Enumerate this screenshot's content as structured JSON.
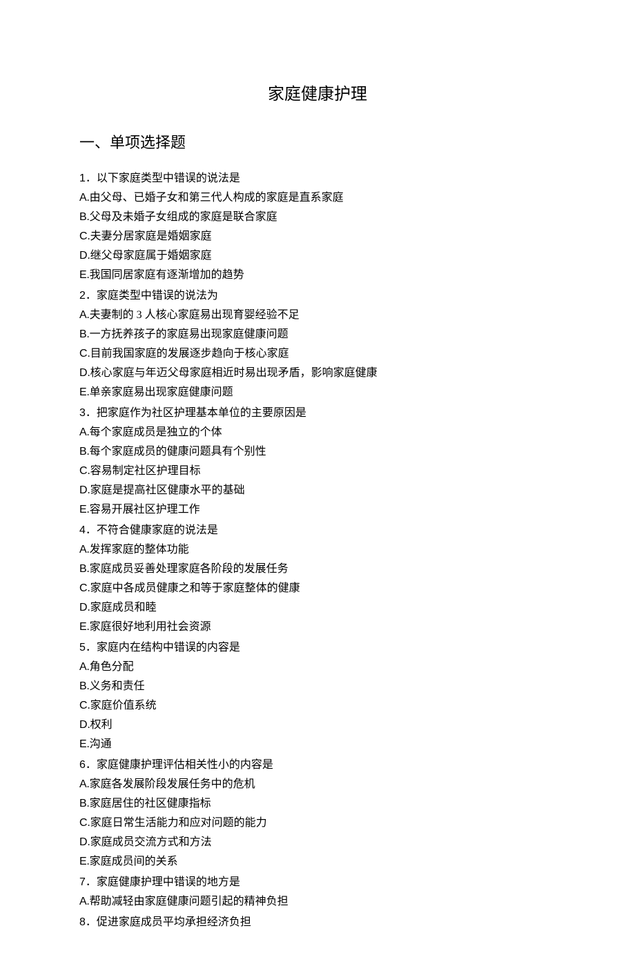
{
  "title": "家庭健康护理",
  "sectionHeading": "一、单项选择题",
  "questions": [
    {
      "number": "1",
      "stem": "．以下家庭类型中错误的说法是",
      "options": [
        {
          "label": "A",
          "text": ".由父母、已婚子女和第三代人构成的家庭是直系家庭"
        },
        {
          "label": "B",
          "text": ".父母及未婚子女组成的家庭是联合家庭"
        },
        {
          "label": "C",
          "text": ".夫妻分居家庭是婚姻家庭"
        },
        {
          "label": "D",
          "text": ".继父母家庭属于婚姻家庭"
        },
        {
          "label": "E",
          "text": ".我国同居家庭有逐渐增加的趋势"
        }
      ]
    },
    {
      "number": "2",
      "stem": "．家庭类型中错误的说法为",
      "options": [
        {
          "label": "A",
          "text": ".夫妻制的 3 人核心家庭易出现育婴经验不足"
        },
        {
          "label": "B",
          "text": ".一方抚养孩子的家庭易出现家庭健康问题"
        },
        {
          "label": "C",
          "text": ".目前我国家庭的发展逐步趋向于核心家庭"
        },
        {
          "label": "D",
          "text": ".核心家庭与年迈父母家庭相近时易出现矛盾，影响家庭健康"
        },
        {
          "label": "E",
          "text": ".单亲家庭易出现家庭健康问题"
        }
      ]
    },
    {
      "number": "3",
      "stem": "．把家庭作为社区护理基本单位的主要原因是",
      "options": [
        {
          "label": "A",
          "text": ".每个家庭成员是独立的个体"
        },
        {
          "label": "B",
          "text": ".每个家庭成员的健康问题具有个别性"
        },
        {
          "label": "C",
          "text": ".容易制定社区护理目标"
        },
        {
          "label": "D",
          "text": ".家庭是提高社区健康水平的基础"
        },
        {
          "label": "E",
          "text": ".容易开展社区护理工作"
        }
      ]
    },
    {
      "number": "4",
      "stem": "．不符合健康家庭的说法是",
      "options": [
        {
          "label": "A",
          "text": ".发挥家庭的整体功能"
        },
        {
          "label": "B",
          "text": ".家庭成员妥善处理家庭各阶段的发展任务"
        },
        {
          "label": "C",
          "text": ".家庭中各成员健康之和等于家庭整体的健康"
        },
        {
          "label": "D",
          "text": ".家庭成员和睦"
        },
        {
          "label": "E",
          "text": ".家庭很好地利用社会资源"
        }
      ]
    },
    {
      "number": "5",
      "stem": "．家庭内在结构中错误的内容是",
      "options": [
        {
          "label": "A",
          "text": ".角色分配"
        },
        {
          "label": "B",
          "text": ".义务和责任"
        },
        {
          "label": "C",
          "text": ".家庭价值系统"
        },
        {
          "label": "D",
          "text": ".权利"
        },
        {
          "label": "E",
          "text": ".沟通"
        }
      ]
    },
    {
      "number": "6",
      "stem": "．家庭健康护理评估相关性小的内容是",
      "options": [
        {
          "label": "A",
          "text": ".家庭各发展阶段发展任务中的危机"
        },
        {
          "label": "B",
          "text": ".家庭居住的社区健康指标"
        },
        {
          "label": "C",
          "text": ".家庭日常生活能力和应对问题的能力"
        },
        {
          "label": "D",
          "text": ".家庭成员交流方式和方法"
        },
        {
          "label": "E",
          "text": ".家庭成员间的关系"
        }
      ]
    },
    {
      "number": "7",
      "stem": "．家庭健康护理中错误的地方是",
      "options": [
        {
          "label": "A",
          "text": ".帮助减轻由家庭健康问题引起的精神负担"
        }
      ]
    },
    {
      "number": "8",
      "stem": "．促进家庭成员平均承担经济负担",
      "options": []
    }
  ]
}
